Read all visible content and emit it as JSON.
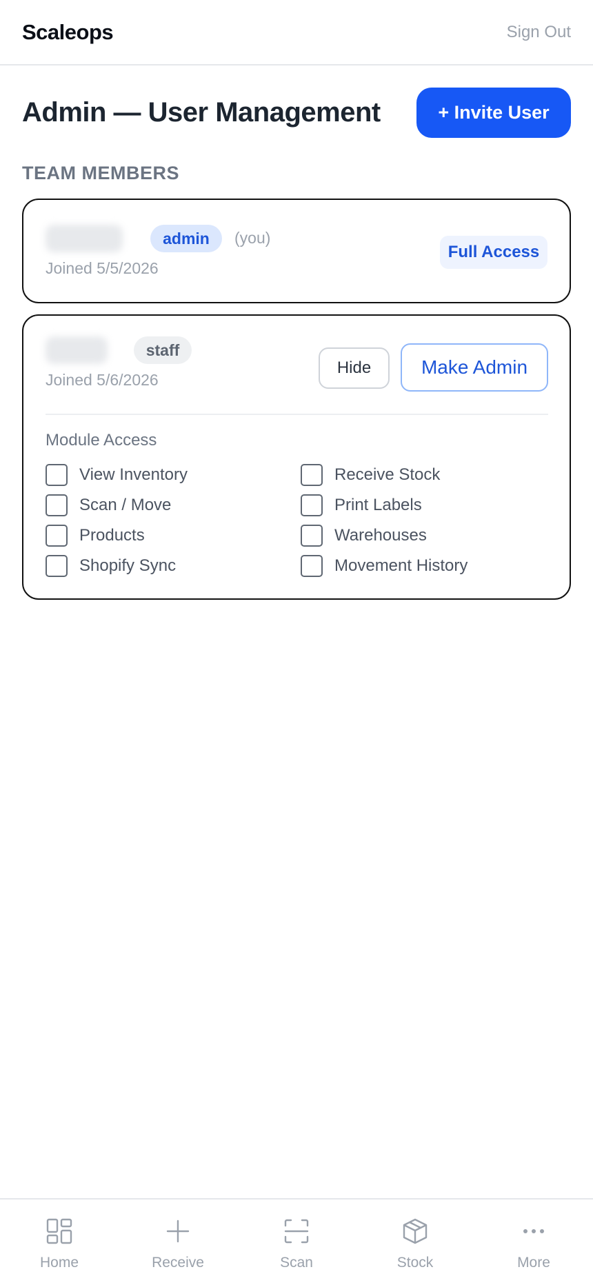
{
  "app": {
    "brand": "Scaleops",
    "sign_out": "Sign Out"
  },
  "header": {
    "title": "Admin — User Management",
    "invite_button": "+ Invite User"
  },
  "section_label": "TEAM MEMBERS",
  "members": [
    {
      "role": "admin",
      "you_label": "(you)",
      "joined": "Joined 5/5/2026",
      "access_badge": "Full Access"
    },
    {
      "role": "staff",
      "joined": "Joined 5/6/2026",
      "hide_button": "Hide",
      "make_admin_button": "Make Admin",
      "module_access_title": "Module Access",
      "modules": [
        {
          "label": "View Inventory",
          "checked": false
        },
        {
          "label": "Receive Stock",
          "checked": false
        },
        {
          "label": "Scan / Move",
          "checked": false
        },
        {
          "label": "Print Labels",
          "checked": false
        },
        {
          "label": "Products",
          "checked": false
        },
        {
          "label": "Warehouses",
          "checked": false
        },
        {
          "label": "Shopify Sync",
          "checked": false
        },
        {
          "label": "Movement History",
          "checked": false
        }
      ]
    }
  ],
  "bottom_nav": [
    {
      "label": "Home",
      "icon": "grid-icon"
    },
    {
      "label": "Receive",
      "icon": "plus-icon"
    },
    {
      "label": "Scan",
      "icon": "scan-icon"
    },
    {
      "label": "Stock",
      "icon": "box-icon"
    },
    {
      "label": "More",
      "icon": "more-icon"
    }
  ],
  "colors": {
    "accent": "#1758f5",
    "admin_pill_bg": "#dbe7fd",
    "text_muted": "#9aa1ab"
  }
}
